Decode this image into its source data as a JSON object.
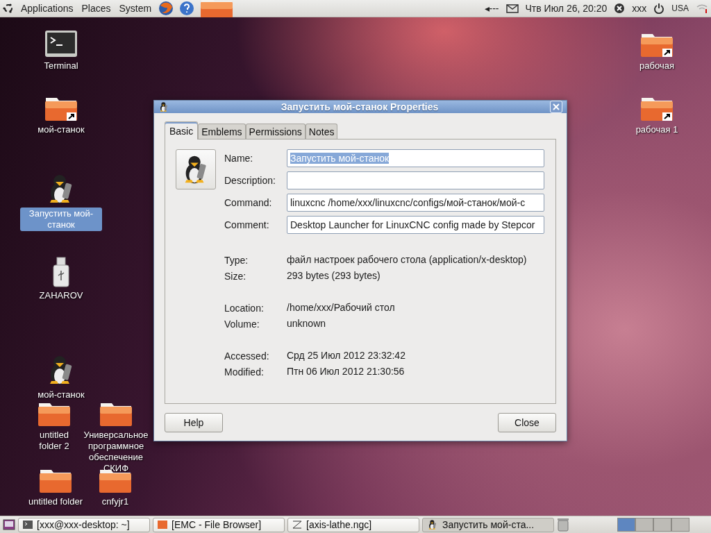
{
  "top_panel": {
    "menus": [
      "Applications",
      "Places",
      "System"
    ],
    "volume": "◂---",
    "clock": "Чтв Июл 26, 20:20",
    "user": "xxx",
    "keyboard": "USA"
  },
  "desktop_icons": [
    {
      "label": "Terminal",
      "kind": "terminal",
      "selected": false
    },
    {
      "label": "мой-станок",
      "kind": "link-folder",
      "selected": false
    },
    {
      "label": "Запустить мой-станок",
      "kind": "launcher",
      "selected": true
    },
    {
      "label": "ZAHAROV",
      "kind": "usb",
      "selected": false
    },
    {
      "label": "мой-станок",
      "kind": "launcher",
      "selected": false
    },
    {
      "label": "untitled folder 2",
      "kind": "folder",
      "selected": false
    },
    {
      "label": "Универсальное программное обеспечение СКИФ",
      "kind": "folder",
      "selected": false
    },
    {
      "label": "untitled folder",
      "kind": "folder",
      "selected": false
    },
    {
      "label": "cnfyjr1",
      "kind": "folder",
      "selected": false
    },
    {
      "label": "рабочая",
      "kind": "link-folder",
      "selected": false
    },
    {
      "label": "рабочая 1",
      "kind": "link-folder",
      "selected": false
    }
  ],
  "dialog": {
    "title": "Запустить мой-станок Properties",
    "tabs": [
      {
        "label": "Basic",
        "selected": true
      },
      {
        "label": "Emblems",
        "selected": false
      },
      {
        "label": "Permissions",
        "selected": false
      },
      {
        "label": "Notes",
        "selected": false
      }
    ],
    "fields": [
      {
        "label": "Name:",
        "value": "Запустить мой-станок",
        "highlighted": true
      },
      {
        "label": "Description:"
      },
      {
        "label": "Command:",
        "value": "linuxcnc /home/xxx/linuxcnc/configs/мой-станок/мой-с"
      },
      {
        "label": "Comment:",
        "value": "Desktop Launcher for LinuxCNC config made by Stepcor"
      }
    ],
    "info_groups": [
      [
        {
          "label": "Type:",
          "value": "файл настроек рабочего стола (application/x-desktop)"
        },
        {
          "label": "Size:",
          "value": "293 bytes (293 bytes)"
        }
      ],
      [
        {
          "label": "Location:",
          "value": "/home/xxx/Рабочий стол"
        },
        {
          "label": "Volume:",
          "value": "unknown"
        }
      ],
      [
        {
          "label": "Accessed:",
          "value": "Срд 25 Июл 2012 23:32:42"
        },
        {
          "label": "Modified:",
          "value": "Птн 06 Июл 2012 21:30:56"
        }
      ]
    ],
    "buttons": [
      "Help",
      "Close"
    ]
  },
  "taskbar": {
    "items": [
      {
        "label": "[xxx@xxx-desktop: ~]",
        "kind": "terminal",
        "selected": false
      },
      {
        "label": "[EMC - File Browser]",
        "kind": "files",
        "selected": false
      },
      {
        "label": "[axis-lathe.ngc]",
        "kind": "axis",
        "selected": false
      },
      {
        "label": "Запустить мой-ста...",
        "kind": "launcher",
        "selected": true
      }
    ],
    "workspaces": [
      {
        "selected": true
      },
      {
        "selected": false
      },
      {
        "selected": false
      },
      {
        "selected": false
      }
    ]
  }
}
